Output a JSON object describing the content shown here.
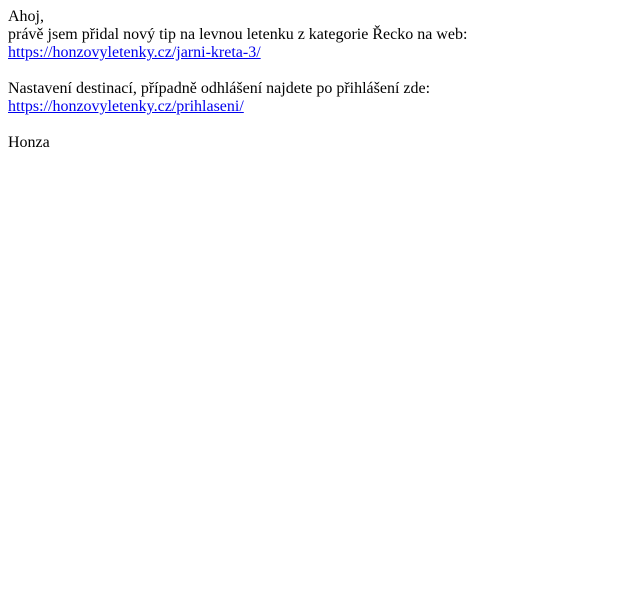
{
  "email": {
    "greeting": "Ahoj,",
    "intro": "právě jsem přidal nový tip na levnou letenku z kategorie Řecko na web:",
    "tip_link": {
      "text": "https://honzovyletenky.cz/jarni-kreta-3/",
      "href": "https://honzovyletenky.cz/jarni-kreta-3/"
    },
    "settings_text": "Nastavení destinací, případně odhlášení najdete po přihlášení zde:",
    "login_link": {
      "text": "https://honzovyletenky.cz/prihlaseni/",
      "href": "https://honzovyletenky.cz/prihlaseni/"
    },
    "signature": "Honza"
  },
  "colors": {
    "text": "#000000",
    "link": "#0000ee",
    "background": "#ffffff"
  }
}
